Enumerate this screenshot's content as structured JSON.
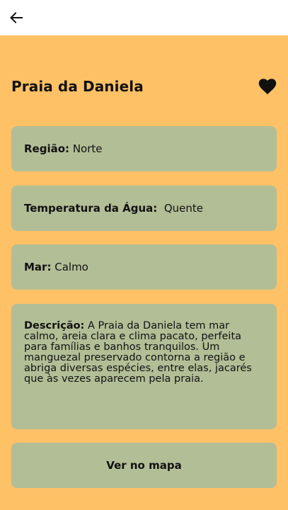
{
  "beach": {
    "name": "Praia da Daniela",
    "regiao_label": "Região:",
    "regiao_value": "Norte",
    "temperatura_label": "Temperatura da Água:",
    "temperatura_value": "Quente",
    "mar_label": "Mar:",
    "mar_value": "Calmo",
    "descricao_label": "Descrição:",
    "descricao_value": "A Praia da Daniela tem mar calmo, areia clara e clima pacato, perfeita para famílias e banhos tranquilos. Um manguezal preservado contorna a região e abriga diversas espécies, entre elas, jacarés que às vezes aparecem pela praia."
  },
  "actions": {
    "map_button": "Ver no mapa"
  },
  "icons": {
    "back": "arrow-left-icon",
    "favorite": "heart-icon"
  },
  "colors": {
    "background": "#FFC166",
    "card": "#B2BE96",
    "appbar": "#FFFFFF",
    "text": "#111111"
  }
}
